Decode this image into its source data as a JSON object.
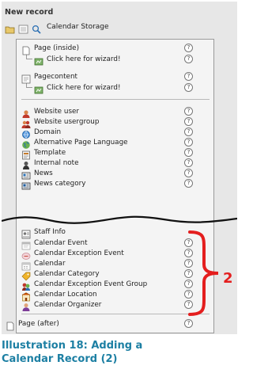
{
  "panel": {
    "title": "New record",
    "toolbar": {
      "folder_icon": "folder-icon",
      "list_icon": "list-icon",
      "search_icon": "search-icon",
      "storage_label": "Calendar Storage"
    }
  },
  "records": [
    {
      "label": "Page (inside)",
      "icon": "page-icon"
    },
    {
      "label": "Click here for wizard!",
      "icon": "wizard-icon"
    },
    {
      "label": "Pagecontent",
      "icon": "pagecontent-icon"
    },
    {
      "label": "Click here for wizard!",
      "icon": "wizard-icon"
    },
    {
      "label": "Website user",
      "icon": "user-icon"
    },
    {
      "label": "Website usergroup",
      "icon": "usergroup-icon"
    },
    {
      "label": "Domain",
      "icon": "globe-icon"
    },
    {
      "label": "Alternative Page Language",
      "icon": "language-icon"
    },
    {
      "label": "Template",
      "icon": "template-icon"
    },
    {
      "label": "Internal note",
      "icon": "note-icon"
    },
    {
      "label": "News",
      "icon": "news-icon"
    },
    {
      "label": "News category",
      "icon": "news-category-icon"
    },
    {
      "label": "Staff Info",
      "icon": "staff-info-icon"
    },
    {
      "label": "Calendar Event",
      "icon": "calendar-event-icon"
    },
    {
      "label": "Calendar Exception Event",
      "icon": "calendar-exception-event-icon"
    },
    {
      "label": "Calendar",
      "icon": "calendar-icon"
    },
    {
      "label": "Calendar Category",
      "icon": "calendar-category-icon"
    },
    {
      "label": "Calendar Exception Event Group",
      "icon": "calendar-exception-group-icon"
    },
    {
      "label": "Calendar Location",
      "icon": "calendar-location-icon"
    },
    {
      "label": "Calendar Organizer",
      "icon": "calendar-organizer-icon"
    },
    {
      "label": "Page (after)",
      "icon": "page-icon"
    }
  ],
  "help_glyph": "?",
  "annotation": {
    "number": "2",
    "color": "#e41e1e"
  },
  "caption": {
    "line1": "Illustration 18: Adding a",
    "line2": "Calendar Record (2)",
    "color": "#1c7fa3"
  }
}
